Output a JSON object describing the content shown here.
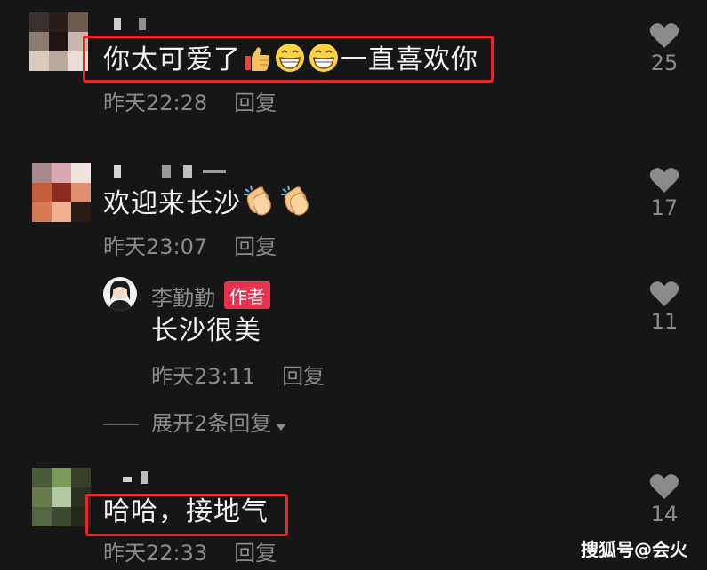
{
  "comments": [
    {
      "text": "你太可爱了",
      "text_suffix": "一直喜欢你",
      "emojis": [
        "thumbs-up-icon",
        "grinning-face-icon",
        "grinning-face-icon"
      ],
      "time": "昨天22:28",
      "reply_label": "回复",
      "likes": "25",
      "highlighted": true
    },
    {
      "text": "欢迎来长沙",
      "emojis": [
        "clapping-hands-icon",
        "clapping-hands-icon"
      ],
      "time": "昨天23:07",
      "reply_label": "回复",
      "likes": "17",
      "highlighted": false
    },
    {
      "author": "李勤勤",
      "author_tag": "作者",
      "text": "长沙很美",
      "time": "昨天23:11",
      "reply_label": "回复",
      "likes": "11",
      "is_reply": true
    },
    {
      "text": "哈哈，接地气",
      "time": "昨天22:33",
      "reply_label": "回复",
      "likes": "14",
      "highlighted": true
    }
  ],
  "expand_replies": "展开2条回复",
  "watermark": "搜狐号@会火",
  "colors": {
    "background": "#161616",
    "highlight_box": "#e5242b",
    "author_tag": "#e8324f",
    "meta_text": "#8a8a8a"
  }
}
